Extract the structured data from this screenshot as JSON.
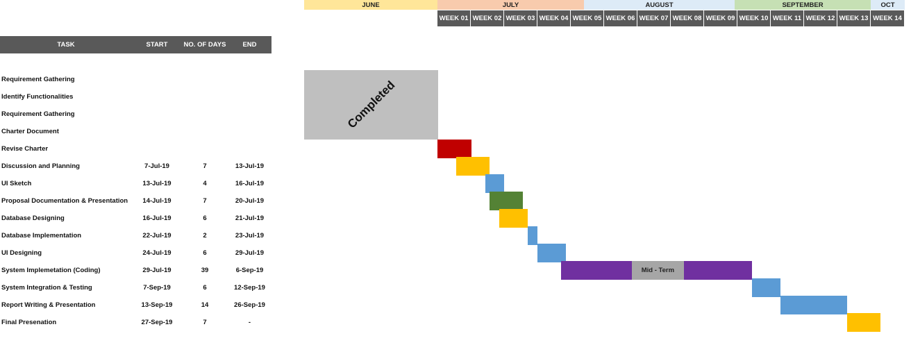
{
  "chart_data": {
    "type": "gantt",
    "months": [
      {
        "label": "JUNE",
        "color": "#ffe699"
      },
      {
        "label": "JULY",
        "color": "#f8cbad"
      },
      {
        "label": "AUGUST",
        "color": "#ddebf7"
      },
      {
        "label": "SEPTEMBER",
        "color": "#c6e0b4"
      },
      {
        "label": "OCT",
        "color": "#ddebf7"
      }
    ],
    "weeks": [
      "WEEK 01",
      "WEEK 02",
      "WEEK 03",
      "WEEK 04",
      "WEEK 05",
      "WEEK 06",
      "WEEK 07",
      "WEEK 08",
      "WEEK 09",
      "WEEK 10",
      "WEEK 11",
      "WEEK 12",
      "WEEK 13",
      "WEEK 14"
    ],
    "columns": {
      "task": "TASK",
      "start": "START",
      "days": "NO. OF DAYS",
      "end": "END"
    },
    "completed_label": "Completed",
    "completed_block": {
      "first_task": 0,
      "last_task": 3
    },
    "tasks": [
      {
        "name": "Requirement Gathering",
        "start": "",
        "days": "",
        "end": ""
      },
      {
        "name": "Identify Functionalities",
        "start": "",
        "days": "",
        "end": ""
      },
      {
        "name": "Requirement Gathering",
        "start": "",
        "days": "",
        "end": ""
      },
      {
        "name": "Charter Document",
        "start": "",
        "days": "",
        "end": ""
      },
      {
        "name": "Revise Charter",
        "start": "",
        "days": "",
        "end": "",
        "color": "#c00000"
      },
      {
        "name": "Discussion and Planning",
        "start": "7-Jul-19",
        "days": "7",
        "end": "13-Jul-19",
        "color": "#ffc000"
      },
      {
        "name": "UI Sketch",
        "start": "13-Jul-19",
        "days": "4",
        "end": "16-Jul-19",
        "color": "#5b9bd5"
      },
      {
        "name": "Proposal Documentation & Presentation",
        "start": "14-Jul-19",
        "days": "7",
        "end": "20-Jul-19",
        "color": "#548235"
      },
      {
        "name": "Database Designing",
        "start": "16-Jul-19",
        "days": "6",
        "end": "21-Jul-19",
        "color": "#ffc000"
      },
      {
        "name": "Database Implementation",
        "start": "22-Jul-19",
        "days": "2",
        "end": "23-Jul-19",
        "color": "#5b9bd5"
      },
      {
        "name": "UI Designing",
        "start": "24-Jul-19",
        "days": "6",
        "end": "29-Jul-19",
        "color": "#5b9bd5"
      },
      {
        "name": "System Implemetation (Coding)",
        "start": "29-Jul-19",
        "days": "39",
        "end": "6-Sep-19",
        "color": "#7030a0",
        "milestone": "Mid - Term"
      },
      {
        "name": "System Integration & Testing",
        "start": "7-Sep-19",
        "days": "6",
        "end": "12-Sep-19",
        "color": "#5b9bd5"
      },
      {
        "name": "Report Writing & Presentation",
        "start": "13-Sep-19",
        "days": "14",
        "end": "26-Sep-19",
        "color": "#5b9bd5"
      },
      {
        "name": "Final Presenation",
        "start": "27-Sep-19",
        "days": "7",
        "end": "-",
        "color": "#ffc000"
      }
    ]
  }
}
